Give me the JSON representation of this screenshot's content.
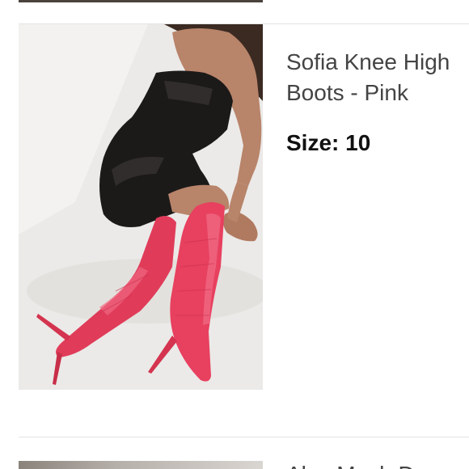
{
  "product": {
    "title": "Sofia Knee High Boots - Pink",
    "size_label": "Size:",
    "size_value": "10",
    "image_alt": "woman in black leather dress wearing pink croc knee high boots"
  },
  "next_product": {
    "title_partial": "Alex Mesh D..."
  },
  "colors": {
    "boot_pink": "#e8405f",
    "dress_black": "#1c1a19",
    "skin": "#b8846a",
    "image_bg": "#e9e8e6",
    "divider": "#e3e3e3"
  }
}
